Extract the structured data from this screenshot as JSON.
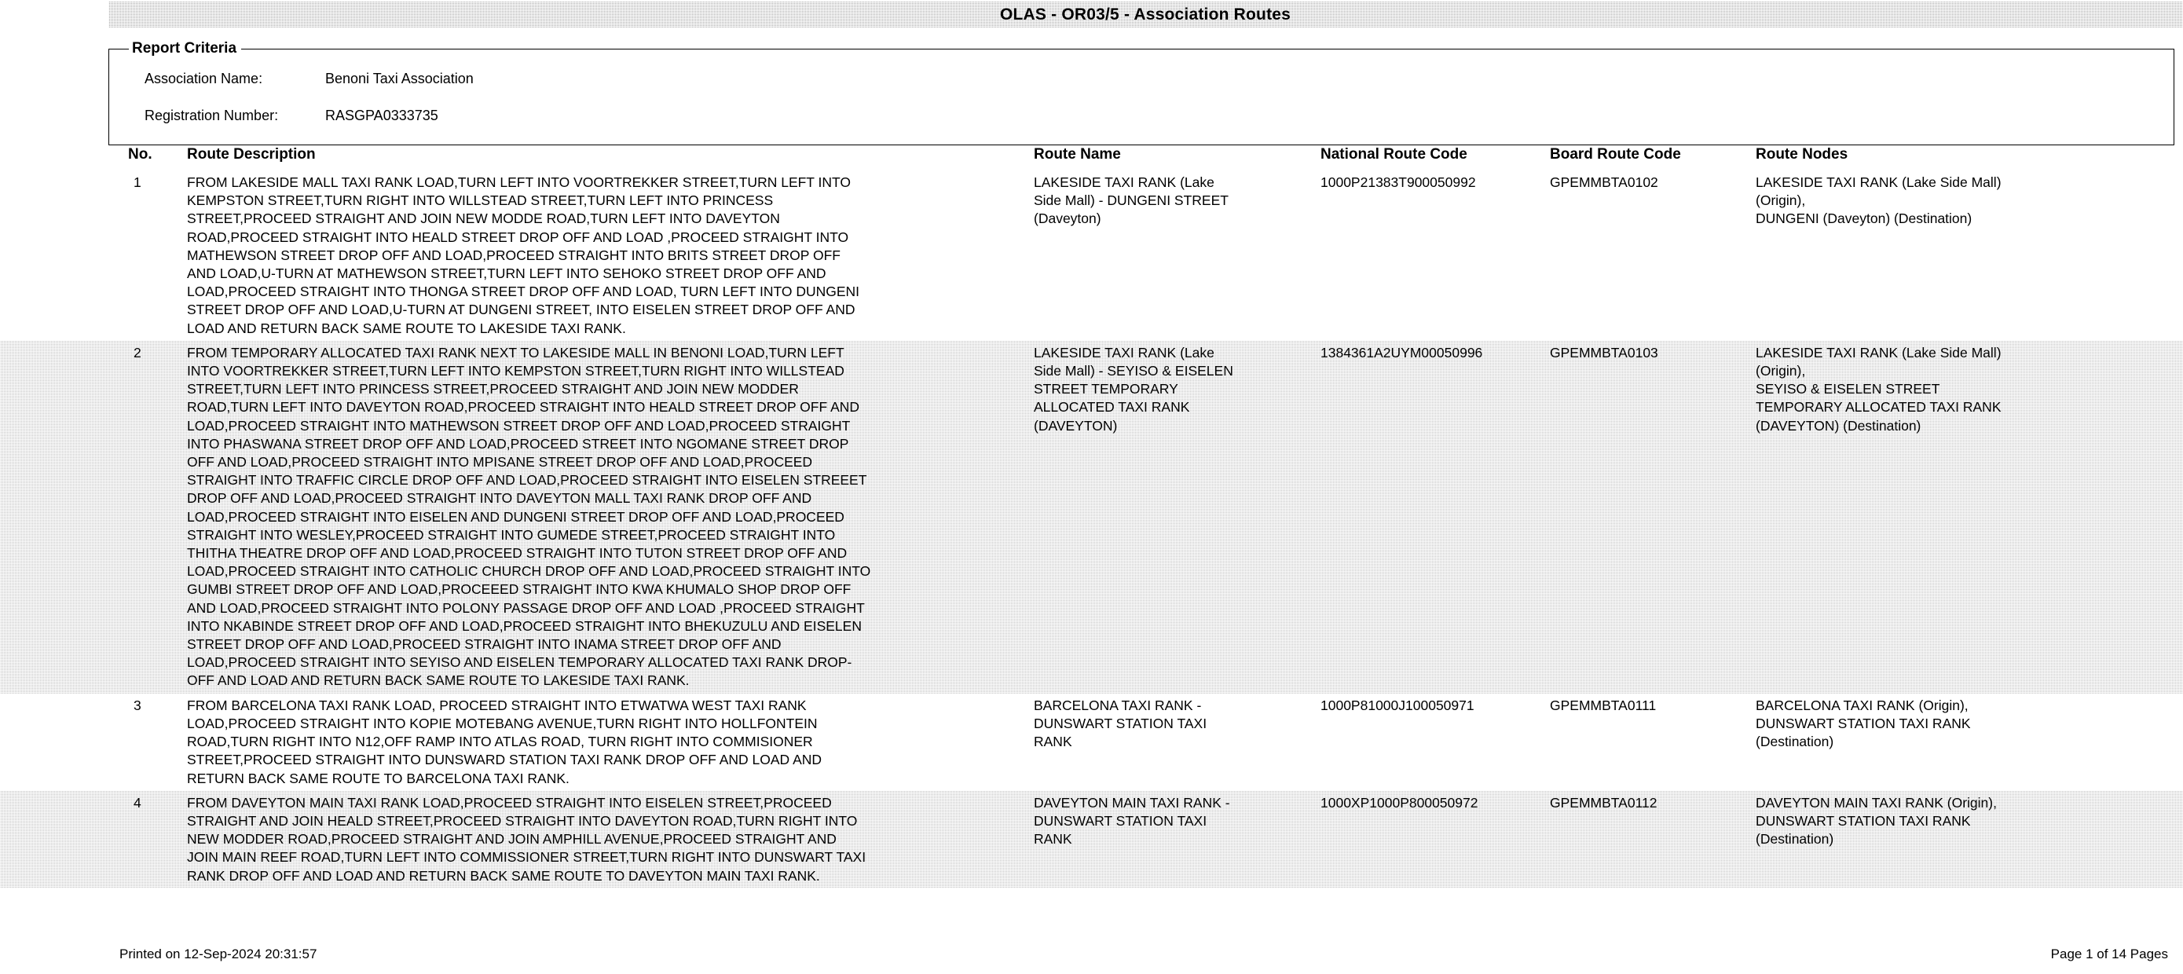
{
  "report": {
    "title": "OLAS - OR03/5 - Association Routes",
    "criteria": {
      "legend": "Report Criteria",
      "association_name_label": "Association Name:",
      "association_name_value": "Benoni Taxi Association",
      "registration_number_label": "Registration Number:",
      "registration_number_value": "RASGPA0333735"
    }
  },
  "table": {
    "headers": {
      "no": "No.",
      "route_description": "Route Description",
      "route_name": "Route Name",
      "national_route_code": "National Route Code",
      "board_route_code": "Board Route Code",
      "route_nodes": "Route Nodes"
    },
    "rows": [
      {
        "no": "1",
        "shaded": false,
        "route_description": "FROM LAKESIDE MALL TAXI RANK LOAD,TURN LEFT INTO VOORTREKKER STREET,TURN LEFT INTO\nKEMPSTON STREET,TURN RIGHT INTO WILLSTEAD STREET,TURN LEFT  INTO PRINCESS\nSTREET,PROCEED STRAIGHT AND JOIN NEW MODDE ROAD,TURN LEFT INTO DAVEYTON\nROAD,PROCEED STRAIGHT INTO HEALD STREET DROP OFF AND LOAD ,PROCEED STRAIGHT INTO\nMATHEWSON STREET DROP OFF AND LOAD,PROCEED STRAIGHT INTO BRITS STREET DROP OFF\nAND LOAD,U-TURN AT MATHEWSON STREET,TURN LEFT INTO SEHOKO STREET DROP OFF AND\nLOAD,PROCEED STRAIGHT INTO THONGA STREET DROP OFF AND LOAD, TURN LEFT INTO DUNGENI\nSTREET DROP OFF AND LOAD,U-TURN AT DUNGENI  STREET, INTO EISELEN STREET DROP OFF AND\nLOAD AND RETURN BACK SAME ROUTE TO LAKESIDE TAXI RANK.",
        "route_name": "LAKESIDE TAXI RANK (Lake\nSide Mall) - DUNGENI STREET\n(Daveyton)",
        "national_route_code": "1000P21383T900050992",
        "board_route_code": "GPEMMBTA0102",
        "route_nodes": "LAKESIDE TAXI RANK (Lake Side Mall)\n(Origin),\nDUNGENI (Daveyton) (Destination)"
      },
      {
        "no": "2",
        "shaded": true,
        "route_description": "FROM  TEMPORARY ALLOCATED TAXI RANK NEXT TO LAKESIDE MALL IN BENONI LOAD,TURN LEFT\nINTO VOORTREKKER STREET,TURN LEFT INTO KEMPSTON STREET,TURN RIGHT INTO WILLSTEAD\nSTREET,TURN LEFT  INTO PRINCESS STREET,PROCEED STRAIGHT AND JOIN NEW MODDER\nROAD,TURN LEFT INTO DAVEYTON ROAD,PROCEED STRAIGHT INTO HEALD STREET DROP OFF AND\nLOAD,PROCEED STRAIGHT INTO MATHEWSON STREET DROP OFF AND LOAD,PROCEED STRAIGHT\nINTO PHASWANA STREET DROP OFF AND LOAD,PROCEED STREET INTO NGOMANE STREET DROP\nOFF AND LOAD,PROCEED STRAIGHT INTO MPISANE STREET DROP OFF AND LOAD,PROCEED\nSTRAIGHT INTO TRAFFIC CIRCLE DROP OFF AND LOAD,PROCEED STRAIGHT INTO EISELEN STREEET\nDROP OFF AND LOAD,PROCEED STRAIGHT INTO DAVEYTON MALL TAXI RANK DROP OFF AND\nLOAD,PROCEED STRAIGHT INTO EISELEN AND DUNGENI STREET DROP OFF AND LOAD,PROCEED\nSTRAIGHT INTO WESLEY,PROCEED STRAIGHT INTO GUMEDE STREET,PROCEED STRAIGHT INTO\nTHITHA  THEATRE DROP OFF AND  LOAD,PROCEED STRAIGHT INTO TUTON STREET DROP OFF AND\nLOAD,PROCEED STRAIGHT INTO CATHOLIC CHURCH DROP OFF AND LOAD,PROCEED STRAIGHT INTO\nGUMBI STREET DROP OFF AND LOAD,PROCEEED STRAIGHT INTO KWA KHUMALO SHOP DROP OFF\nAND LOAD,PROCEED STRAIGHT INTO POLONY PASSAGE DROP OFF AND LOAD ,PROCEED STRAIGHT\nINTO NKABINDE STREET DROP OFF AND LOAD,PROCEED STRAIGHT INTO BHEKUZULU AND EISELEN\nSTREET DROP OFF AND LOAD,PROCEED STRAIGHT INTO INAMA STREET DROP OFF AND\nLOAD,PROCEED STRAIGHT INTO SEYISO AND EISELEN TEMPORARY ALLOCATED TAXI RANK DROP-\nOFF AND LOAD AND RETURN BACK SAME ROUTE TO LAKESIDE TAXI RANK.",
        "route_name": "LAKESIDE TAXI RANK (Lake\nSide Mall) - SEYISO & EISELEN\nSTREET TEMPORARY\nALLOCATED TAXI RANK\n(DAVEYTON)",
        "national_route_code": "1384361A2UYM00050996",
        "board_route_code": "GPEMMBTA0103",
        "route_nodes": "LAKESIDE TAXI RANK (Lake Side Mall)\n(Origin),\nSEYISO & EISELEN STREET\nTEMPORARY ALLOCATED TAXI RANK\n(DAVEYTON) (Destination)"
      },
      {
        "no": "3",
        "shaded": false,
        "route_description": "FROM BARCELONA TAXI RANK LOAD, PROCEED STRAIGHT INTO ETWATWA WEST TAXI RANK\nLOAD,PROCEED STRAIGHT INTO KOPIE MOTEBANG AVENUE,TURN RIGHT INTO HOLLFONTEIN\nROAD,TURN RIGHT INTO N12,OFF RAMP INTO ATLAS ROAD, TURN RIGHT INTO COMMISIONER\nSTREET,PROCEED STRAIGHT INTO DUNSWARD STATION TAXI RANK  DROP OFF AND LOAD AND\nRETURN BACK SAME   ROUTE TO BARCELONA  TAXI RANK.",
        "route_name": "BARCELONA TAXI RANK -\nDUNSWART STATION TAXI\nRANK",
        "national_route_code": "1000P81000J100050971",
        "board_route_code": "GPEMMBTA0111",
        "route_nodes": "BARCELONA TAXI RANK (Origin),\nDUNSWART STATION TAXI RANK\n(Destination)"
      },
      {
        "no": "4",
        "shaded": true,
        "route_description": "FROM DAVEYTON MAIN TAXI RANK LOAD,PROCEED STRAIGHT INTO EISELEN STREET,PROCEED\nSTRAIGHT AND JOIN HEALD STREET,PROCEED STRAIGHT INTO  DAVEYTON ROAD,TURN  RIGHT INTO\nNEW MODDER ROAD,PROCEED STRAIGHT AND JOIN AMPHILL AVENUE,PROCEED STRAIGHT AND\nJOIN MAIN REEF ROAD,TURN LEFT INTO COMMISSIONER STREET,TURN RIGHT INTO DUNSWART TAXI\nRANK DROP OFF AND LOAD AND RETURN BACK SAME ROUTE TO DAVEYTON MAIN TAXI RANK.",
        "route_name": "DAVEYTON MAIN TAXI RANK -\nDUNSWART STATION TAXI\nRANK",
        "national_route_code": "1000XP1000P800050972",
        "board_route_code": "GPEMMBTA0112",
        "route_nodes": "DAVEYTON MAIN TAXI RANK (Origin),\nDUNSWART STATION TAXI RANK\n(Destination)"
      }
    ]
  },
  "footer": {
    "printed_on": "Printed on  12-Sep-2024 20:31:57",
    "page_info": "Page  1   of  14 Pages"
  }
}
